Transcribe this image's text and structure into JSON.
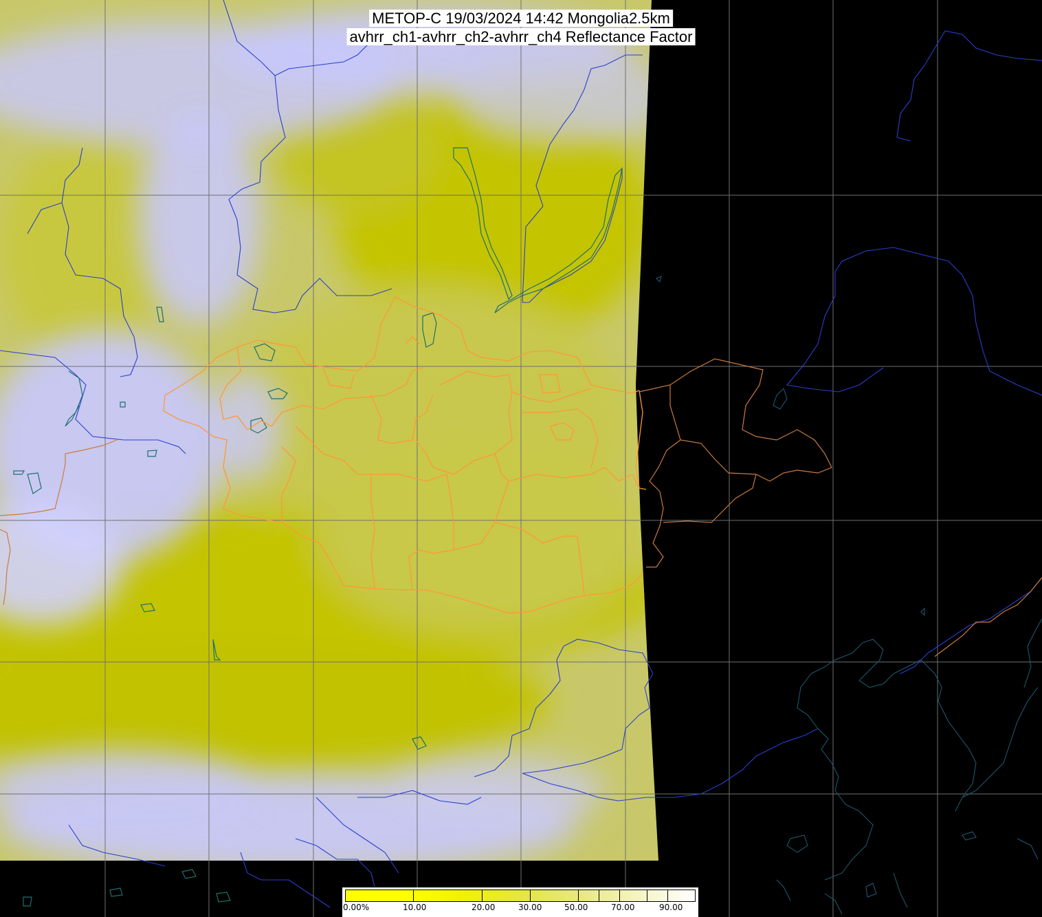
{
  "title": {
    "line1": "METOP-C 19/03/2024 14:42 Mongolia2.5km",
    "line2": "avhrr_ch1-avhrr_ch2-avhrr_ch4 Reflectance Factor"
  },
  "colorbar": {
    "labels": [
      "0.00%",
      "10.00",
      "20.00",
      "30.00",
      "50.00",
      "70.00",
      "90.00"
    ],
    "colors": [
      "#ffff00",
      "#ffff00",
      "#f2f200",
      "#e6e640",
      "#e8e880",
      "#f4f4c0",
      "#ffffff"
    ]
  },
  "colors": {
    "background": "#000000",
    "cloud": "#c8c8ff",
    "surface": "#c8c800",
    "graticule": "#707070",
    "rivers": "#2a3fcf",
    "lakes": "#1f6f6f",
    "borders_mongolia": "#ff9933",
    "borders_china": "#cc7a3d",
    "coast": "#1e5f78"
  }
}
